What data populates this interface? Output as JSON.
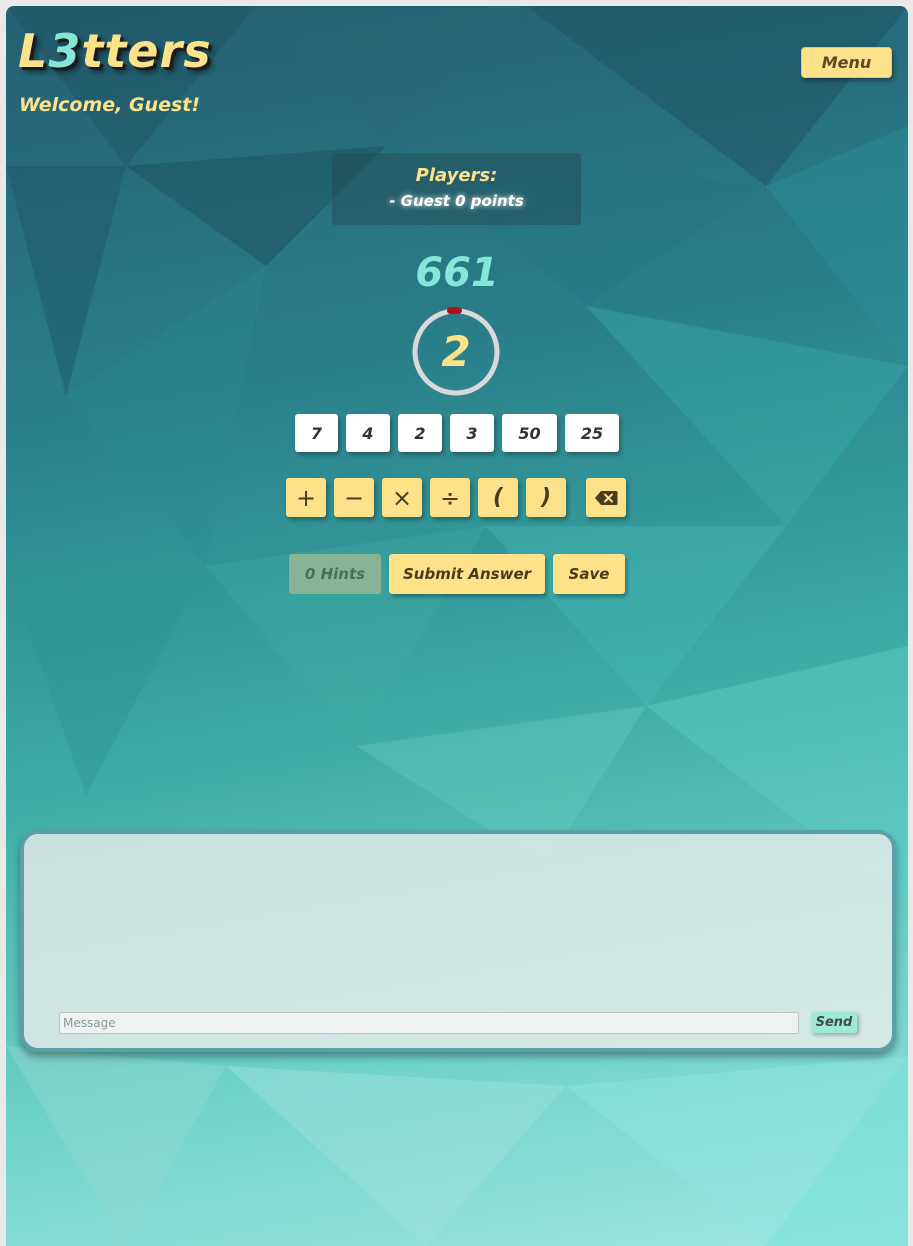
{
  "header": {
    "title_part1": "L",
    "title_accent": "3",
    "title_part2": "tters",
    "welcome": "Welcome, Guest!",
    "menu_label": "Menu"
  },
  "players": {
    "title": "Players:",
    "entries": [
      "- Guest 0 points"
    ]
  },
  "game": {
    "target": "661",
    "timer": "2",
    "numbers": [
      "7",
      "4",
      "2",
      "3",
      "50",
      "25"
    ],
    "operators": [
      {
        "label": "+",
        "icon": "plus-icon"
      },
      {
        "label": "−",
        "icon": "minus-icon"
      },
      {
        "label": "×",
        "icon": "multiply-icon"
      },
      {
        "label": "÷",
        "icon": "divide-icon"
      },
      {
        "label": "(",
        "icon": "open-paren"
      },
      {
        "label": ")",
        "icon": "close-paren"
      }
    ],
    "backspace_icon": "backspace-icon"
  },
  "actions": {
    "hints_label": "0 Hints",
    "submit_label": "Submit Answer",
    "save_label": "Save"
  },
  "chat": {
    "placeholder": "Message",
    "send_label": "Send"
  },
  "colors": {
    "accent_yellow": "#fde28a",
    "accent_teal": "#86e6d8",
    "timer_marker": "#a5151b"
  }
}
